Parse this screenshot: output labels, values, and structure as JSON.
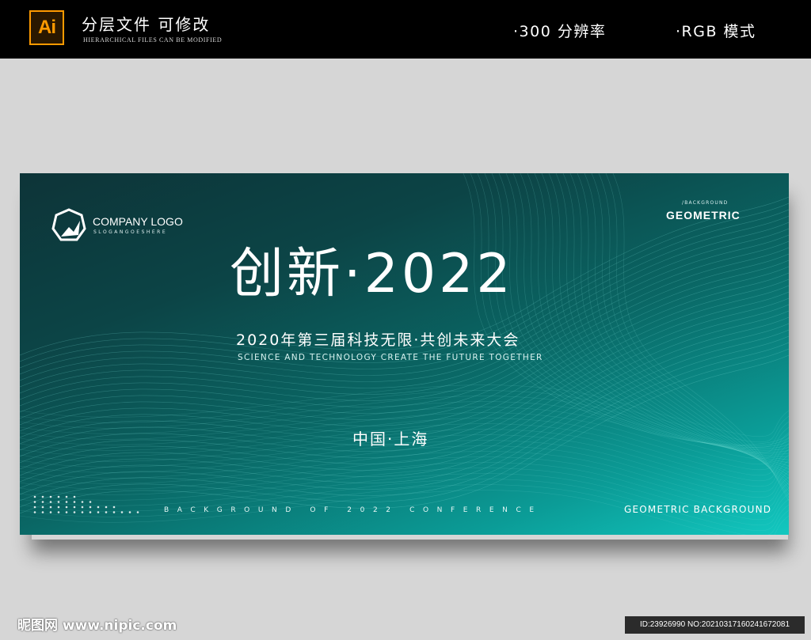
{
  "topbar": {
    "app_badge": "Ai",
    "title": "分层文件 可修改",
    "subtitle": "HIERARCHICAL FILES CAN BE MODIFIED",
    "spec_resolution": "·300 分辨率",
    "spec_mode": "·RGB 模式"
  },
  "banner": {
    "logo_text": "COMPANY LOGO",
    "logo_slogan": "SLOGANGOESHERE",
    "geo_small": "/BACKGROUND",
    "geo_title": "GEOMETRIC",
    "main_title": "创新·2022",
    "subtitle_cn": "2020年第三届科技无限·共创未来大会",
    "subtitle_en": "SCIENCE AND TECHNOLOGY CREATE THE FUTURE TOGETHER",
    "location": "中国·上海",
    "bottom_text": "BACKGROUND OF 2022 CONFERENCE",
    "geo_bottom": "GEOMETRIC BACKGROUND"
  },
  "watermark": {
    "site": "昵图网 www.nipic.com",
    "id": "ID:23926990 NO:20210317160241672081"
  },
  "colors": {
    "topbar": "#000000",
    "canvas": "#d6d6d6",
    "ai_orange": "#ff9a00",
    "banner_dark": "#0d3438",
    "banner_light": "#12c8c0"
  }
}
